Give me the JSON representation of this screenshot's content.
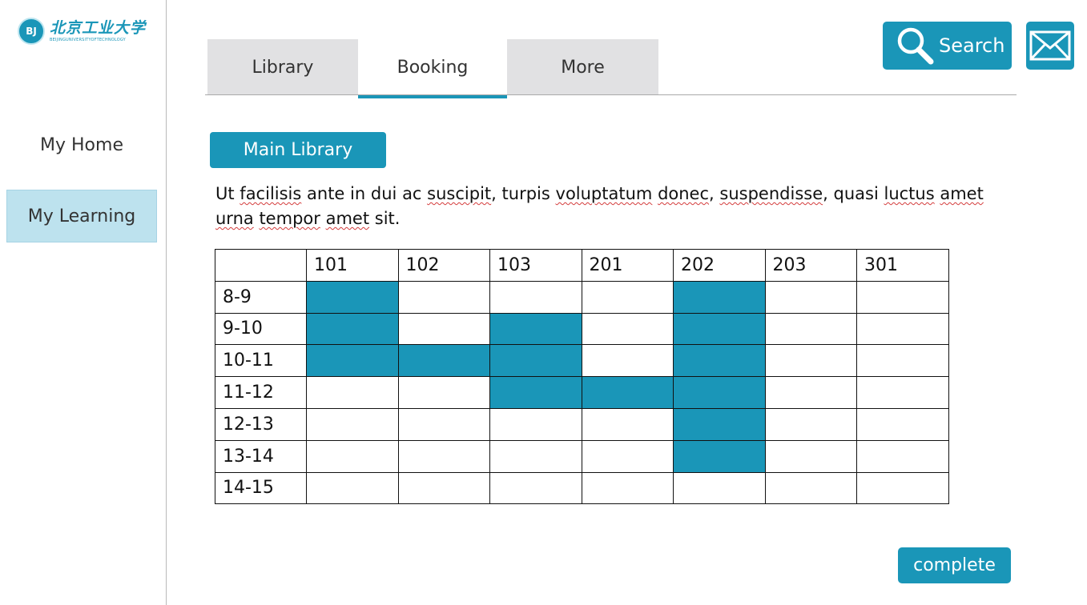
{
  "brand": {
    "emblem_text": "BJ",
    "name_cn": "北京工业大学",
    "name_en": "BEIJINGUNIVERSITYOFTECHNOLOGY",
    "accent_color": "#1a96b8"
  },
  "sidebar": {
    "items": [
      {
        "label": "My Home",
        "active": false
      },
      {
        "label": "My Learning",
        "active": true
      }
    ]
  },
  "tabs": [
    {
      "label": "Library",
      "active": false
    },
    {
      "label": "Booking",
      "active": true
    },
    {
      "label": "More",
      "active": false
    }
  ],
  "header": {
    "search_label": "Search",
    "search_icon": "search-icon",
    "mail_icon": "mail-icon"
  },
  "main": {
    "library_button": "Main Library",
    "description": "Ut facilisis ante in dui ac suscipit, turpis voluptatum donec, suspendisse, quasi luctus amet urna tempor amet sit."
  },
  "schedule": {
    "rooms": [
      "101",
      "102",
      "103",
      "201",
      "202",
      "203",
      "301"
    ],
    "slots": [
      "8-9",
      "9-10",
      "10-11",
      "11-12",
      "12-13",
      "13-14",
      "14-15"
    ],
    "booked": [
      [
        true,
        false,
        false,
        false,
        true,
        false,
        false
      ],
      [
        true,
        false,
        true,
        false,
        true,
        false,
        false
      ],
      [
        true,
        true,
        true,
        false,
        true,
        false,
        false
      ],
      [
        false,
        false,
        true,
        true,
        true,
        false,
        false
      ],
      [
        false,
        false,
        false,
        false,
        true,
        false,
        false
      ],
      [
        false,
        false,
        false,
        false,
        true,
        false,
        false
      ],
      [
        false,
        false,
        false,
        false,
        false,
        false,
        false
      ]
    ],
    "booked_color": "#1a96b8"
  },
  "footer": {
    "complete_label": "complete"
  }
}
